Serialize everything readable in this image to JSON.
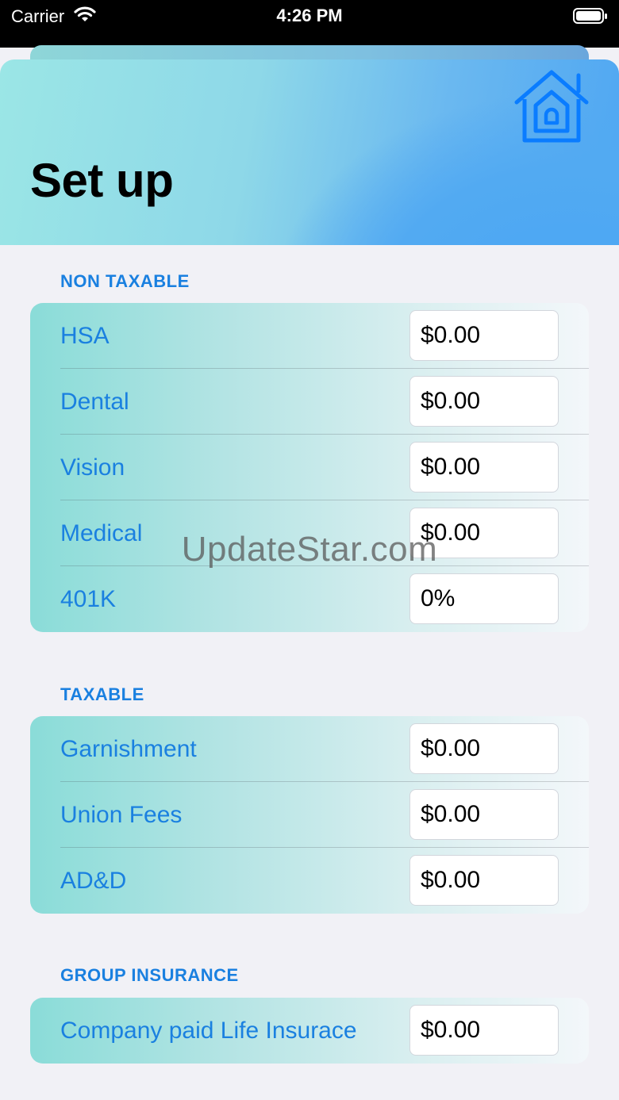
{
  "status_bar": {
    "carrier": "Carrier",
    "time": "4:26 PM",
    "wifi_icon": "wifi-icon",
    "battery_icon": "battery-icon"
  },
  "header": {
    "title": "Set up",
    "home_icon": "home-icon",
    "accent_color": "#1a80e0"
  },
  "sections": [
    {
      "label": "NON TAXABLE",
      "rows": [
        {
          "label": "HSA",
          "value": "$0.00"
        },
        {
          "label": "Dental",
          "value": "$0.00"
        },
        {
          "label": "Vision",
          "value": "$0.00"
        },
        {
          "label": "Medical",
          "value": "$0.00"
        },
        {
          "label": "401K",
          "value": "0%"
        }
      ]
    },
    {
      "label": "TAXABLE",
      "rows": [
        {
          "label": "Garnishment",
          "value": "$0.00"
        },
        {
          "label": "Union Fees",
          "value": "$0.00"
        },
        {
          "label": "AD&D",
          "value": "$0.00"
        }
      ]
    },
    {
      "label": "GROUP INSURANCE",
      "rows": [
        {
          "label": "Company paid Life Insurace",
          "value": "$0.00"
        }
      ]
    }
  ],
  "watermark": "UpdateStar.com"
}
